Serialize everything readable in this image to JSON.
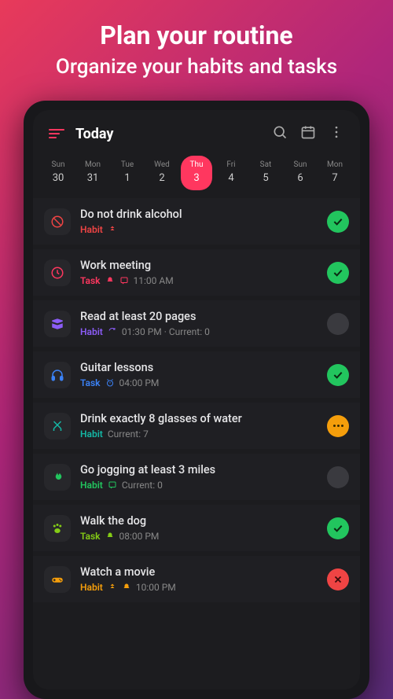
{
  "promo": {
    "title": "Plan your routine",
    "subtitle": "Organize your habits and tasks"
  },
  "header": {
    "title": "Today"
  },
  "days": [
    {
      "name": "Sun",
      "num": "30",
      "active": false
    },
    {
      "name": "Mon",
      "num": "31",
      "active": false
    },
    {
      "name": "Tue",
      "num": "1",
      "active": false
    },
    {
      "name": "Wed",
      "num": "2",
      "active": false
    },
    {
      "name": "Thu",
      "num": "3",
      "active": true
    },
    {
      "name": "Fri",
      "num": "4",
      "active": false
    },
    {
      "name": "Sat",
      "num": "5",
      "active": false
    },
    {
      "name": "Sun",
      "num": "6",
      "active": false
    },
    {
      "name": "Mon",
      "num": "7",
      "active": false
    }
  ],
  "items": [
    {
      "icon": "ban",
      "color": "red",
      "title": "Do not drink alcohol",
      "type": "Habit",
      "badges": [
        "priority"
      ],
      "extra": "",
      "status": "done"
    },
    {
      "icon": "clock",
      "color": "pink",
      "title": "Work meeting",
      "type": "Task",
      "badges": [
        "bell",
        "note"
      ],
      "extra": "11:00 AM",
      "status": "done"
    },
    {
      "icon": "book",
      "color": "purple",
      "title": "Read at least 20 pages",
      "type": "Habit",
      "badges": [
        "repeat"
      ],
      "extra": "01:30 PM · Current: 0",
      "status": "pending"
    },
    {
      "icon": "headphones",
      "color": "blue",
      "title": "Guitar lessons",
      "type": "Task",
      "badges": [
        "alarm"
      ],
      "extra": "04:00 PM",
      "status": "done"
    },
    {
      "icon": "utensils",
      "color": "teal",
      "title": "Drink exactly 8 glasses of water",
      "type": "Habit",
      "badges": [],
      "extra": "Current: 7",
      "status": "warn"
    },
    {
      "icon": "fire",
      "color": "green",
      "title": "Go jogging at least 3 miles",
      "type": "Habit",
      "badges": [
        "note"
      ],
      "extra": "Current: 0",
      "status": "pending"
    },
    {
      "icon": "paw",
      "color": "lime",
      "title": "Walk the dog",
      "type": "Task",
      "badges": [
        "bell"
      ],
      "extra": "08:00 PM",
      "status": "done"
    },
    {
      "icon": "gamepad",
      "color": "orange",
      "title": "Watch a movie",
      "type": "Habit",
      "badges": [
        "priority",
        "bell"
      ],
      "extra": "10:00 PM",
      "status": "fail"
    }
  ]
}
